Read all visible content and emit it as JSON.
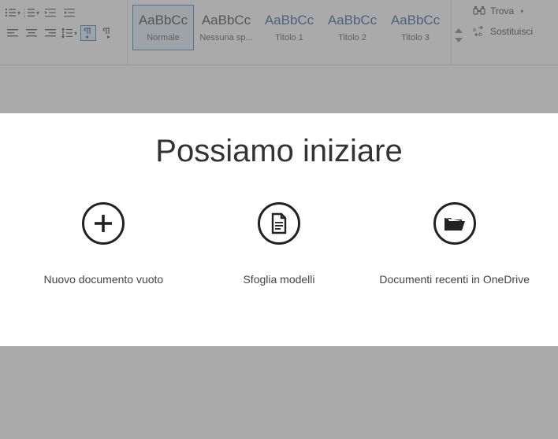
{
  "ribbon": {
    "styles": [
      {
        "sample": "AaBbCc",
        "label": "Normale",
        "heading": false,
        "selected": true
      },
      {
        "sample": "AaBbCc",
        "label": "Nessuna sp...",
        "heading": false,
        "selected": false
      },
      {
        "sample": "AaBbCc",
        "label": "Titolo 1",
        "heading": true,
        "selected": false
      },
      {
        "sample": "AaBbCc",
        "label": "Titolo 2",
        "heading": true,
        "selected": false
      },
      {
        "sample": "AaBbCc",
        "label": "Titolo 3",
        "heading": true,
        "selected": false
      }
    ],
    "editing": {
      "find": "Trova",
      "replace": "Sostituisci"
    }
  },
  "start": {
    "title": "Possiamo iniziare",
    "options": {
      "blank": "Nuovo documento vuoto",
      "templates": "Sfoglia modelli",
      "recent": "Documenti recenti in OneDrive"
    }
  }
}
